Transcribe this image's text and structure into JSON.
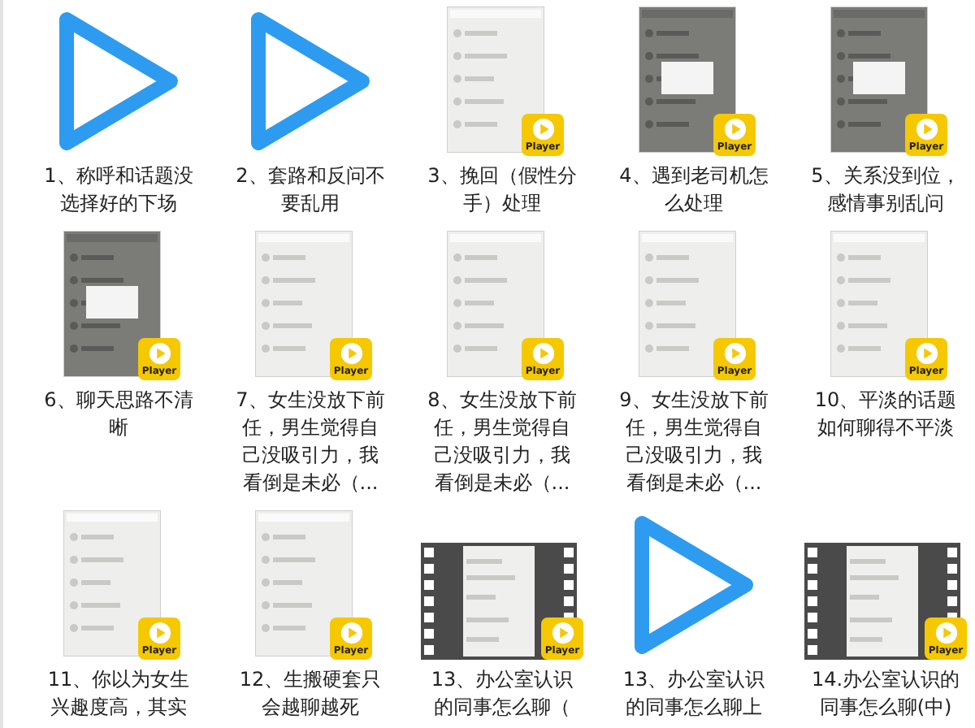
{
  "files": [
    {
      "name": "1、称呼和话题没选择好的下场",
      "kind": "play"
    },
    {
      "name": "2、套路和反问不要乱用",
      "kind": "play"
    },
    {
      "name": "3、挽回（假性分手）处理",
      "kind": "screenshot",
      "dimmed": false,
      "badge": "Player"
    },
    {
      "name": "4、遇到老司机怎么处理",
      "kind": "screenshot",
      "dimmed": true,
      "badge": "Player"
    },
    {
      "name": "5、关系没到位，感情事别乱问",
      "kind": "screenshot",
      "dimmed": true,
      "badge": "Player"
    },
    {
      "name": "6、聊天思路不清晰",
      "kind": "screenshot",
      "dimmed": true,
      "badge": "Player"
    },
    {
      "name": "7、女生没放下前任，男生觉得自己没吸引力，我看倒是未必（...",
      "kind": "screenshot",
      "dimmed": false,
      "badge": "Player"
    },
    {
      "name": "8、女生没放下前任，男生觉得自己没吸引力，我看倒是未必（...",
      "kind": "screenshot",
      "dimmed": false,
      "badge": "Player"
    },
    {
      "name": "9、女生没放下前任，男生觉得自己没吸引力，我看倒是未必（...",
      "kind": "screenshot",
      "dimmed": false,
      "badge": "Player"
    },
    {
      "name": "10、平淡的话题如何聊得不平淡",
      "kind": "screenshot",
      "dimmed": false,
      "badge": "Player"
    },
    {
      "name": "11、你以为女生兴趣度高，其实",
      "kind": "screenshot",
      "dimmed": false,
      "badge": "Player"
    },
    {
      "name": "12、生搬硬套只会越聊越死",
      "kind": "screenshot",
      "dimmed": false,
      "badge": "Player"
    },
    {
      "name": "13、办公室认识的同事怎么聊（",
      "kind": "film",
      "badge": "Player"
    },
    {
      "name": "13、办公室认识的同事怎么聊上",
      "kind": "play"
    },
    {
      "name": "14.办公室认识的同事怎么聊(中)",
      "kind": "film",
      "badge": "Player"
    }
  ]
}
